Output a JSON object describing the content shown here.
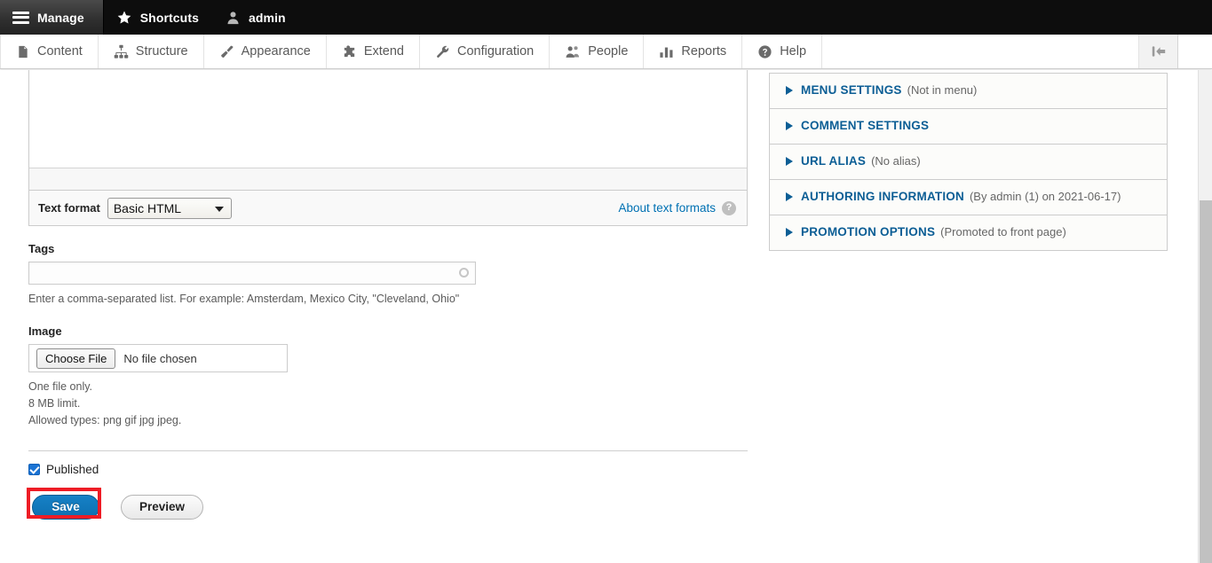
{
  "admin_bar": {
    "items": [
      {
        "label": "Manage",
        "icon": "hamburger-icon"
      },
      {
        "label": "Shortcuts",
        "icon": "star-icon"
      },
      {
        "label": "admin",
        "icon": "user-icon"
      }
    ]
  },
  "menu_bar": {
    "items": [
      {
        "label": "Content",
        "icon": "page-icon"
      },
      {
        "label": "Structure",
        "icon": "sitemap-icon"
      },
      {
        "label": "Appearance",
        "icon": "paintbrush-icon"
      },
      {
        "label": "Extend",
        "icon": "puzzle-icon"
      },
      {
        "label": "Configuration",
        "icon": "wrench-icon"
      },
      {
        "label": "People",
        "icon": "people-icon"
      },
      {
        "label": "Reports",
        "icon": "bar-chart-icon"
      },
      {
        "label": "Help",
        "icon": "question-circle-icon"
      }
    ],
    "collapse_icon": "collapse-sidebar-icon"
  },
  "body_field": {
    "value": "",
    "text_format_label": "Text format",
    "text_format_value": "Basic HTML",
    "text_format_options": [
      "Basic HTML"
    ],
    "about_text_formats": "About text formats",
    "help_glyph": "?"
  },
  "tags_field": {
    "label": "Tags",
    "value": "",
    "description": "Enter a comma-separated list. For example: Amsterdam, Mexico City, \"Cleveland, Ohio\""
  },
  "image_field": {
    "label": "Image",
    "choose_file_label": "Choose File",
    "no_file_text": "No file chosen",
    "descriptions": [
      "One file only.",
      "8 MB limit.",
      "Allowed types: png gif jpg jpeg."
    ]
  },
  "publish": {
    "published_label": "Published",
    "checked": true
  },
  "actions": {
    "save_label": "Save",
    "preview_label": "Preview",
    "highlight_color": "#ee1c25",
    "save_color": "#0d6fb0"
  },
  "sidebar_tabs": [
    {
      "title": "MENU SETTINGS",
      "summary": "(Not in menu)"
    },
    {
      "title": "COMMENT SETTINGS",
      "summary": ""
    },
    {
      "title": "URL ALIAS",
      "summary": "(No alias)"
    },
    {
      "title": "AUTHORING INFORMATION",
      "summary": "(By admin (1) on 2021-06-17)"
    },
    {
      "title": "PROMOTION OPTIONS",
      "summary": "(Promoted to front page)"
    }
  ],
  "theme": {
    "link_color": "#0c5e95",
    "toolbar_bg": "#0d0d0d"
  }
}
